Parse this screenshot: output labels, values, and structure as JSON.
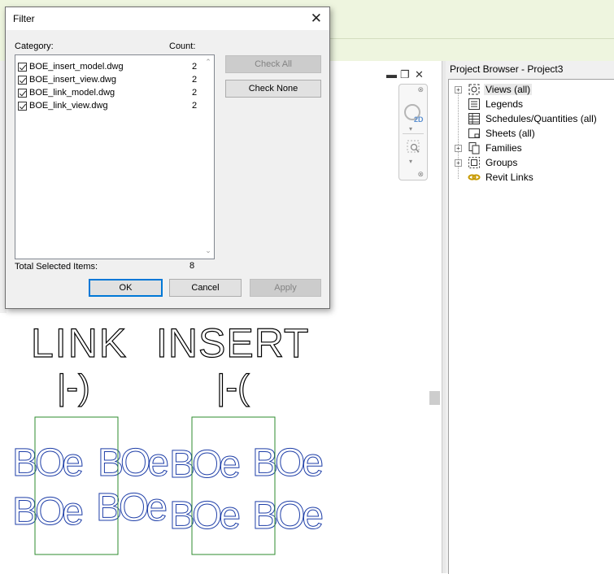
{
  "dialog": {
    "title": "Filter",
    "category_header": "Category:",
    "count_header": "Count:",
    "items": [
      {
        "name": "BOE_insert_model.dwg",
        "count": "2",
        "checked": true
      },
      {
        "name": "BOE_insert_view.dwg",
        "count": "2",
        "checked": true
      },
      {
        "name": "BOE_link_model.dwg",
        "count": "2",
        "checked": true
      },
      {
        "name": "BOE_link_view.dwg",
        "count": "2",
        "checked": true
      }
    ],
    "check_all_label": "Check All",
    "check_none_label": "Check None",
    "total_label": "Total Selected Items:",
    "total_value": "8",
    "ok_label": "OK",
    "cancel_label": "Cancel",
    "apply_label": "Apply"
  },
  "project_browser": {
    "title": "Project Browser - Project3",
    "items": [
      {
        "label": "Views (all)",
        "icon": "views-icon",
        "expandable": true,
        "selected": true
      },
      {
        "label": "Legends",
        "icon": "legends-icon",
        "expandable": false
      },
      {
        "label": "Schedules/Quantities (all)",
        "icon": "schedules-icon",
        "expandable": false
      },
      {
        "label": "Sheets (all)",
        "icon": "sheets-icon",
        "expandable": false
      },
      {
        "label": "Families",
        "icon": "families-icon",
        "expandable": true
      },
      {
        "label": "Groups",
        "icon": "groups-icon",
        "expandable": true
      },
      {
        "label": "Revit Links",
        "icon": "revit-links-icon",
        "expandable": false
      }
    ]
  },
  "navigation_bar": {
    "mode": "2D"
  },
  "drawing": {
    "link_text": "LINK",
    "link_sub": "|-)",
    "insert_text": "INSERT",
    "insert_sub": "|-(",
    "boe_text": "BOe",
    "outline_color": "#000000",
    "boe_color": "#1f3fa8",
    "rect_color": "#2e8b2e"
  }
}
